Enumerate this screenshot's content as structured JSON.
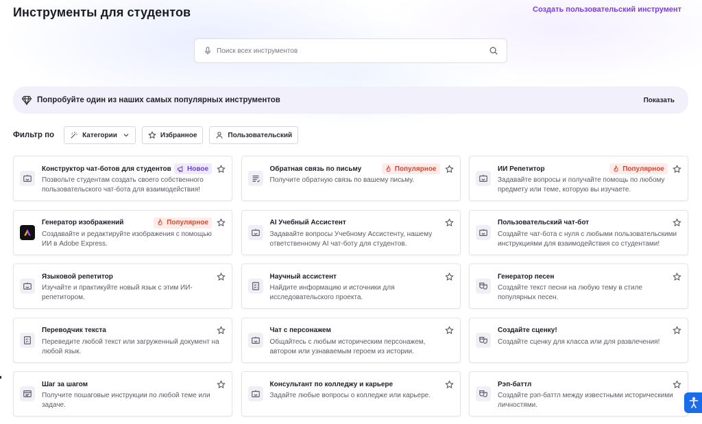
{
  "header": {
    "title": "Инструменты для студентов",
    "create_link": "Создать пользовательский инструмент"
  },
  "search": {
    "placeholder": "Поиск всех инструментов"
  },
  "promo": {
    "text": "Попробуйте один из наших самых популярных инструментов",
    "show_label": "Показать"
  },
  "filter": {
    "label": "Фильтр по",
    "chips": {
      "categories": "Категории",
      "favorites": "Избранное",
      "custom": "Пользовательский"
    }
  },
  "tools": [
    {
      "name": "Конструктор чат-ботов для студентов",
      "badge": "Новое",
      "badge_type": "new",
      "icon": "chatbot-icon",
      "desc": "Позвольте студентам создать своего собственного пользовательского чат-бота для взаимодействия!"
    },
    {
      "name": "Обратная связь по письму",
      "badge": "Популярное",
      "badge_type": "popular",
      "icon": "text-lines-icon",
      "desc": "Получите обратную связь по вашему письму."
    },
    {
      "name": "ИИ Репетитор",
      "badge": "Популярное",
      "badge_type": "popular",
      "icon": "chatbot-icon",
      "desc": "Задавайте вопросы и получайте помощь по любому предмету или теме, которую вы изучаете."
    },
    {
      "name": "Генератор изображений",
      "badge": "Популярное",
      "badge_type": "popular",
      "icon": "adobe-express-icon",
      "desc": "Создавайте и редактируйте изображения с помощью ИИ в Adobe Express."
    },
    {
      "name": "AI Учебный Ассистент",
      "badge": "",
      "badge_type": "",
      "icon": "chatbot-icon",
      "desc": "Задавайте вопросы Учебному Ассистенту, нашему ответственному AI чат-боту для студентов."
    },
    {
      "name": "Пользовательский чат-бот",
      "badge": "",
      "badge_type": "",
      "icon": "chatbot-icon",
      "desc": "Создайте чат-бота с нуля с любыми пользовательскими инструкциями для взаимодействия со студентами!"
    },
    {
      "name": "Языковой репетитор",
      "badge": "",
      "badge_type": "",
      "icon": "chatbot-icon",
      "desc": "Изучайте и практикуйте новый язык с этим ИИ-репетитором."
    },
    {
      "name": "Научный ассистент",
      "badge": "",
      "badge_type": "",
      "icon": "checklist-icon",
      "desc": "Найдите информацию и источники для исследовательского проекта."
    },
    {
      "name": "Генератор песен",
      "badge": "",
      "badge_type": "",
      "icon": "theater-masks-icon",
      "desc": "Создайте текст песни на любую тему в стиле популярных песен."
    },
    {
      "name": "Переводчик текста",
      "badge": "",
      "badge_type": "",
      "icon": "checklist-icon",
      "desc": "Переведите любой текст или загруженный документ на любой язык."
    },
    {
      "name": "Чат с персонажем",
      "badge": "",
      "badge_type": "",
      "icon": "chatbot-icon",
      "desc": "Общайтесь с любым историческим персонажем, автором или узнаваемым героем из истории."
    },
    {
      "name": "Создайте сценку!",
      "badge": "",
      "badge_type": "",
      "icon": "theater-masks-icon",
      "desc": "Создайте сценку для класса или для развлечения!"
    },
    {
      "name": "Шаг за шагом",
      "badge": "",
      "badge_type": "",
      "icon": "browser-window-icon",
      "desc": "Получите пошаговые инструкции по любой теме или задаче."
    },
    {
      "name": "Консультант по колледжу и карьере",
      "badge": "",
      "badge_type": "",
      "icon": "chatbot-icon",
      "desc": "Задайте любые вопросы о колледже или карьере."
    },
    {
      "name": "Рэп-баттл",
      "badge": "",
      "badge_type": "",
      "icon": "theater-masks-icon",
      "desc": "Создайте рэп-баттл между известными историческими личностями."
    }
  ],
  "colors": {
    "accent": "#7c3aed",
    "popular": "#d9472b",
    "new": "#6d3fe0",
    "accessibility": "#1a6ce8"
  }
}
